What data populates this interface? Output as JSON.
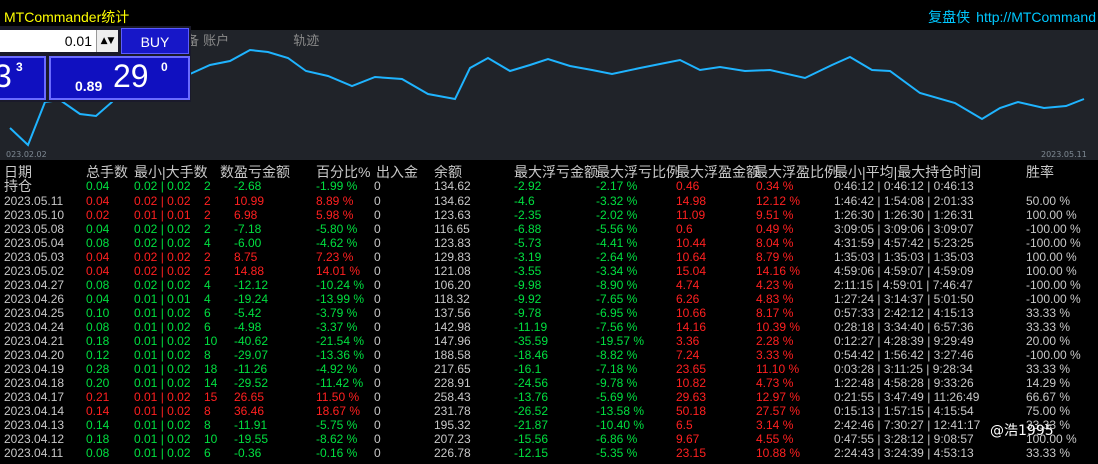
{
  "header": {
    "app_title": "MTCommander统计",
    "right_title_zh": "复盘侠",
    "right_title_url": "http://MTCommand"
  },
  "chart": {
    "tabs": [
      "备 账户",
      "轨迹"
    ],
    "start_date": "023.02.02",
    "end_date": "2023.05.11"
  },
  "trade_panel": {
    "lot_value": "0.01",
    "buy_label": "BUY",
    "left_price_big": "3",
    "left_price_sup": "3",
    "right_price_small": "0.89",
    "right_price_big": "29",
    "right_price_sup": "0"
  },
  "table": {
    "headers": [
      "日期",
      "总手数",
      "最小|大手数",
      "数",
      "盈亏金额",
      "百分比%",
      "出入金",
      "余额",
      "最大浮亏金额",
      "最大浮亏比例",
      "最大浮盈金额",
      "最大浮盈比例",
      "最小|平均|最大持仓时间",
      "胜率"
    ],
    "holding_label": "持仓",
    "holding_row": [
      "0.04",
      "0.02 | 0.02",
      "2",
      "-2.68",
      "-1.99 %",
      "0",
      "134.62",
      "-2.92",
      "-2.17 %",
      "0.46",
      "0.34 %",
      "0:46:12 | 0:46:12 | 0:46:13",
      ""
    ],
    "rows": [
      [
        "2023.05.11",
        "0.04",
        "0.02 | 0.02",
        "2",
        "10.99",
        "8.89 %",
        "0",
        "134.62",
        "-4.6",
        "-3.32 %",
        "14.98",
        "12.12 %",
        "1:46:42 | 1:54:08 | 2:01:33",
        "50.00 %"
      ],
      [
        "2023.05.10",
        "0.02",
        "0.01 | 0.01",
        "2",
        "6.98",
        "5.98 %",
        "0",
        "123.63",
        "-2.35",
        "-2.02 %",
        "11.09",
        "9.51 %",
        "1:26:30 | 1:26:30 | 1:26:31",
        "100.00 %"
      ],
      [
        "2023.05.08",
        "0.04",
        "0.02 | 0.02",
        "2",
        "-7.18",
        "-5.80 %",
        "0",
        "116.65",
        "-6.88",
        "-5.56 %",
        "0.6",
        "0.49 %",
        "3:09:05 | 3:09:06 | 3:09:07",
        "-100.00 %"
      ],
      [
        "2023.05.04",
        "0.08",
        "0.02 | 0.02",
        "4",
        "-6.00",
        "-4.62 %",
        "0",
        "123.83",
        "-5.73",
        "-4.41 %",
        "10.44",
        "8.04 %",
        "4:31:59 | 4:57:42 | 5:23:25",
        "-100.00 %"
      ],
      [
        "2023.05.03",
        "0.04",
        "0.02 | 0.02",
        "2",
        "8.75",
        "7.23 %",
        "0",
        "129.83",
        "-3.19",
        "-2.64 %",
        "10.64",
        "8.79 %",
        "1:35:03 | 1:35:03 | 1:35:03",
        "100.00 %"
      ],
      [
        "2023.05.02",
        "0.04",
        "0.02 | 0.02",
        "2",
        "14.88",
        "14.01 %",
        "0",
        "121.08",
        "-3.55",
        "-3.34 %",
        "15.04",
        "14.16 %",
        "4:59:06 | 4:59:07 | 4:59:09",
        "100.00 %"
      ],
      [
        "2023.04.27",
        "0.08",
        "0.02 | 0.02",
        "4",
        "-12.12",
        "-10.24 %",
        "0",
        "106.20",
        "-9.98",
        "-8.90 %",
        "4.74",
        "4.23 %",
        "2:11:15 | 4:59:01 | 7:46:47",
        "-100.00 %"
      ],
      [
        "2023.04.26",
        "0.04",
        "0.01 | 0.01",
        "4",
        "-19.24",
        "-13.99 %",
        "0",
        "118.32",
        "-9.92",
        "-7.65 %",
        "6.26",
        "4.83 %",
        "1:27:24 | 3:14:37 | 5:01:50",
        "-100.00 %"
      ],
      [
        "2023.04.25",
        "0.10",
        "0.01 | 0.02",
        "6",
        "-5.42",
        "-3.79 %",
        "0",
        "137.56",
        "-9.78",
        "-6.95 %",
        "10.66",
        "8.17 %",
        "0:57:33 | 2:42:12 | 4:15:13",
        "33.33 %"
      ],
      [
        "2023.04.24",
        "0.08",
        "0.01 | 0.02",
        "6",
        "-4.98",
        "-3.37 %",
        "0",
        "142.98",
        "-11.19",
        "-7.56 %",
        "14.16",
        "10.39 %",
        "0:28:18 | 3:34:40 | 6:57:36",
        "33.33 %"
      ],
      [
        "2023.04.21",
        "0.18",
        "0.01 | 0.02",
        "10",
        "-40.62",
        "-21.54 %",
        "0",
        "147.96",
        "-35.59",
        "-19.57 %",
        "3.36",
        "2.28 %",
        "0:12:27 | 4:28:39 | 9:29:49",
        "20.00 %"
      ],
      [
        "2023.04.20",
        "0.12",
        "0.01 | 0.02",
        "8",
        "-29.07",
        "-13.36 %",
        "0",
        "188.58",
        "-18.46",
        "-8.82 %",
        "7.24",
        "3.33 %",
        "0:54:42 | 1:56:42 | 3:27:46",
        "-100.00 %"
      ],
      [
        "2023.04.19",
        "0.28",
        "0.01 | 0.02",
        "18",
        "-11.26",
        "-4.92 %",
        "0",
        "217.65",
        "-16.1",
        "-7.18 %",
        "23.65",
        "11.10 %",
        "0:03:28 | 3:11:25 | 9:28:34",
        "33.33 %"
      ],
      [
        "2023.04.18",
        "0.20",
        "0.01 | 0.02",
        "14",
        "-29.52",
        "-11.42 %",
        "0",
        "228.91",
        "-24.56",
        "-9.78 %",
        "10.82",
        "4.73 %",
        "1:22:48 | 4:58:28 | 9:33:26",
        "14.29 %"
      ],
      [
        "2023.04.17",
        "0.21",
        "0.01 | 0.02",
        "15",
        "26.65",
        "11.50 %",
        "0",
        "258.43",
        "-13.76",
        "-5.69 %",
        "29.63",
        "12.97 %",
        "0:21:55 | 3:47:49 | 11:26:49",
        "66.67 %"
      ],
      [
        "2023.04.14",
        "0.14",
        "0.01 | 0.02",
        "8",
        "36.46",
        "18.67 %",
        "0",
        "231.78",
        "-26.52",
        "-13.58 %",
        "50.18",
        "27.57 %",
        "0:15:13 | 1:57:15 | 4:15:54",
        "75.00 %"
      ],
      [
        "2023.04.13",
        "0.14",
        "0.01 | 0.02",
        "8",
        "-11.91",
        "-5.75 %",
        "0",
        "195.32",
        "-21.87",
        "-10.40 %",
        "6.5",
        "3.14 %",
        "2:42:46 | 7:30:27 | 12:41:17",
        "33.33 %"
      ],
      [
        "2023.04.12",
        "0.18",
        "0.01 | 0.02",
        "10",
        "-19.55",
        "-8.62 %",
        "0",
        "207.23",
        "-15.56",
        "-6.86 %",
        "9.67",
        "4.55 %",
        "0:47:55 | 3:28:12 | 9:08:57",
        "100.00 %"
      ],
      [
        "2023.04.11",
        "0.08",
        "0.01 | 0.02",
        "6",
        "-0.36",
        "-0.16 %",
        "0",
        "226.78",
        "-12.15",
        "-5.35 %",
        "23.15",
        "10.88 %",
        "2:24:43 | 3:24:39 | 4:53:13",
        "33.33 %"
      ]
    ]
  },
  "watermark": "@浩1995",
  "colors": {
    "line": "#1fb4ff",
    "profit": "#ff2020",
    "loss": "#00e040"
  }
}
